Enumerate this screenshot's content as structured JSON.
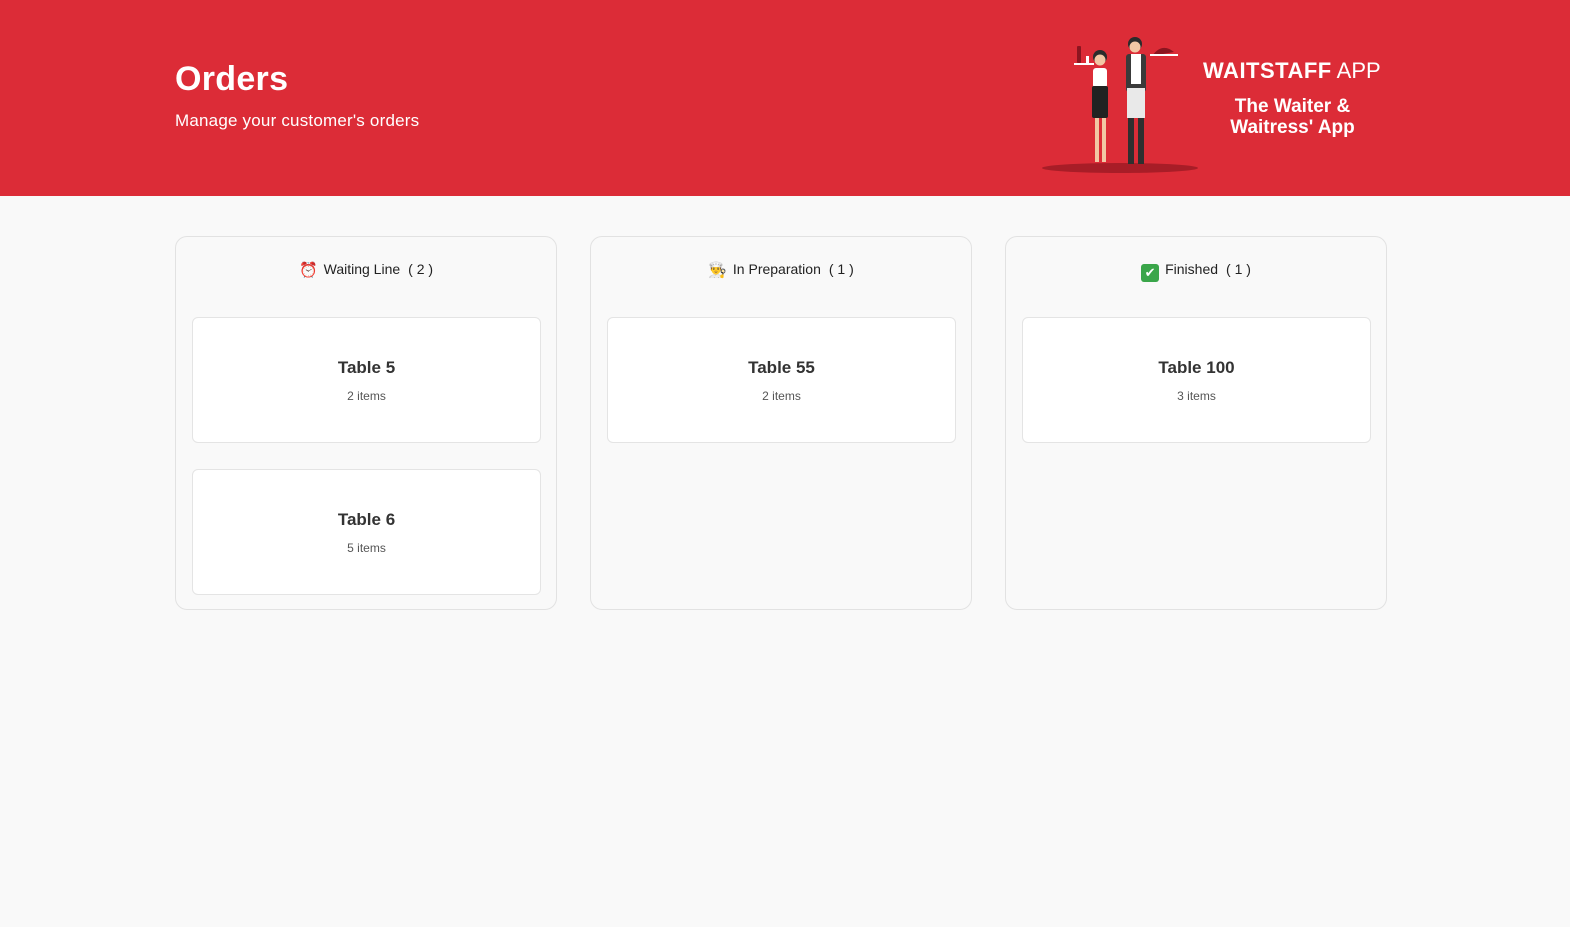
{
  "header": {
    "title": "Orders",
    "subtitle": "Manage your customer's orders",
    "brand_bold": "WAITSTAFF",
    "brand_light": "APP",
    "tagline": "The Waiter & Waitress' App",
    "background_color": "#dc2c37"
  },
  "columns": [
    {
      "icon": "alarm-clock-icon",
      "emoji": "⏰",
      "label": "Waiting Line",
      "count": "( 2 )",
      "cards": [
        {
          "title": "Table 5",
          "items": "2 items"
        },
        {
          "title": "Table 6",
          "items": "5 items"
        }
      ]
    },
    {
      "icon": "chef-icon",
      "emoji": "👨‍🍳",
      "label": "In Preparation",
      "count": "( 1 )",
      "cards": [
        {
          "title": "Table 55",
          "items": "2 items"
        }
      ]
    },
    {
      "icon": "check-mark-icon",
      "emoji": "✔",
      "label": "Finished",
      "count": "( 1 )",
      "cards": [
        {
          "title": "Table 100",
          "items": "3 items"
        }
      ]
    }
  ]
}
